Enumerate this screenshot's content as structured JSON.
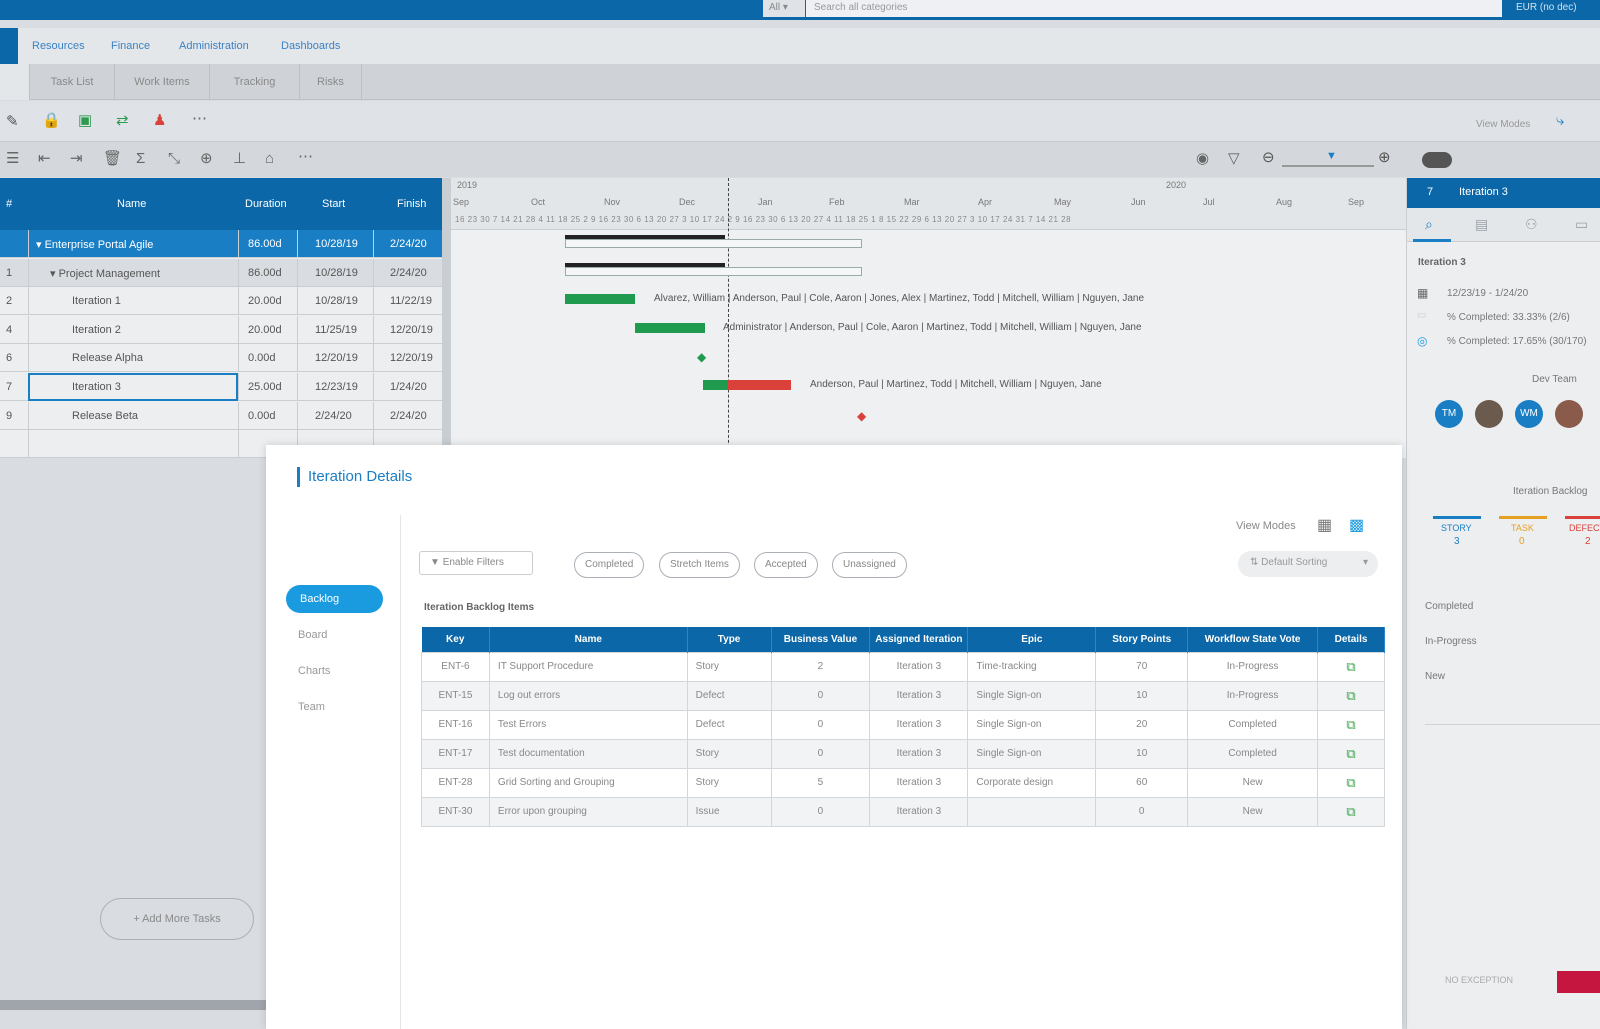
{
  "topbar": {
    "search_scope": "All ▾",
    "search_placeholder": "Search all categories",
    "currency": "EUR (no dec)"
  },
  "menu": [
    "Resources",
    "Finance",
    "Administration",
    "Dashboards"
  ],
  "subtabs": [
    "Task List",
    "Work Items",
    "Tracking",
    "Risks"
  ],
  "toolbar": {
    "view_modes": "View Modes"
  },
  "grid": {
    "headers": {
      "num": "#",
      "name": "Name",
      "duration": "Duration",
      "start": "Start",
      "finish": "Finish"
    },
    "rows": [
      {
        "num": "",
        "name": "▾ Enterprise Portal Agile",
        "duration": "86.00d",
        "start": "10/28/19",
        "finish": "2/24/20"
      },
      {
        "num": "1",
        "name": "▾ Project Management",
        "duration": "86.00d",
        "start": "10/28/19",
        "finish": "2/24/20"
      },
      {
        "num": "2",
        "name": "Iteration 1",
        "duration": "20.00d",
        "start": "10/28/19",
        "finish": "11/22/19"
      },
      {
        "num": "4",
        "name": "Iteration 2",
        "duration": "20.00d",
        "start": "11/25/19",
        "finish": "12/20/19"
      },
      {
        "num": "6",
        "name": "Release Alpha",
        "duration": "0.00d",
        "start": "12/20/19",
        "finish": "12/20/19"
      },
      {
        "num": "7",
        "name": "Iteration 3",
        "duration": "25.00d",
        "start": "12/23/19",
        "finish": "1/24/20"
      },
      {
        "num": "9",
        "name": "Release Beta",
        "duration": "0.00d",
        "start": "2/24/20",
        "finish": "2/24/20"
      }
    ]
  },
  "gantt": {
    "years": [
      "2019",
      "2020"
    ],
    "months": [
      "Sep",
      "Oct",
      "Nov",
      "Dec",
      "Jan",
      "Feb",
      "Mar",
      "Apr",
      "May",
      "Jun",
      "Jul",
      "Aug",
      "Sep"
    ],
    "days": "16 23 30  7 14 21 28  4 11 18 25  2  9 16 23 30  6 13 20 27  3 10 17 24  2  9 16 23 30  6 13 20 27  4 11 18 25  1  8 15 22 29  6 13 20 27  3 10 17 24 31  7 14 21 28",
    "labels": {
      "iter1": "Alvarez, William | Anderson, Paul | Cole, Aaron | Jones, Alex | Martinez, Todd | Mitchell, William | Nguyen, Jane",
      "iter2": "Administrator | Anderson, Paul | Cole, Aaron | Martinez, Todd | Mitchell, William | Nguyen, Jane",
      "iter3": "Anderson, Paul | Martinez, Todd | Mitchell, William | Nguyen, Jane"
    }
  },
  "right_panel": {
    "header_num": "7",
    "header_title": "Iteration 3",
    "name": "Iteration 3",
    "dates": "12/23/19 - 1/24/20",
    "pct1": "% Completed: 33.33% (2/6)",
    "pct2": "% Completed: 17.65% (30/170)",
    "dev_team": "Dev Team",
    "avatars": [
      "TM",
      "",
      "WM",
      ""
    ],
    "backlog_title": "Iteration Backlog",
    "types": [
      {
        "label": "STORY",
        "count": "3"
      },
      {
        "label": "TASK",
        "count": "0"
      },
      {
        "label": "DEFECT",
        "count": "2"
      }
    ],
    "statuses": [
      "Completed",
      "In-Progress",
      "New"
    ],
    "no_exception": "NO EXCEPTION"
  },
  "add_more_tasks": "+ Add More Tasks",
  "modal": {
    "title": "Iteration Details",
    "nav": [
      "Backlog",
      "Board",
      "Charts",
      "Team"
    ],
    "view_modes": "View Modes",
    "enable_filters": "Enable Filters",
    "chips": [
      "Completed",
      "Stretch Items",
      "Accepted",
      "Unassigned"
    ],
    "sorting": "Default Sorting",
    "section_label": "Iteration Backlog Items",
    "columns": [
      "Key",
      "Name",
      "Type",
      "Business Value",
      "Assigned Iteration",
      "Epic",
      "Story Points",
      "Workflow State Vote",
      "Details"
    ],
    "rows": [
      {
        "key": "ENT-6",
        "name": "IT Support Procedure",
        "type": "Story",
        "bv": "2",
        "iter": "Iteration 3",
        "epic": "Time-tracking",
        "sp": "70",
        "state": "In-Progress"
      },
      {
        "key": "ENT-15",
        "name": "Log out errors",
        "type": "Defect",
        "bv": "0",
        "iter": "Iteration 3",
        "epic": "Single Sign-on",
        "sp": "10",
        "state": "In-Progress"
      },
      {
        "key": "ENT-16",
        "name": "Test Errors",
        "type": "Defect",
        "bv": "0",
        "iter": "Iteration 3",
        "epic": "Single Sign-on",
        "sp": "20",
        "state": "Completed"
      },
      {
        "key": "ENT-17",
        "name": "Test documentation",
        "type": "Story",
        "bv": "0",
        "iter": "Iteration 3",
        "epic": "Single Sign-on",
        "sp": "10",
        "state": "Completed"
      },
      {
        "key": "ENT-28",
        "name": "Grid Sorting and Grouping",
        "type": "Story",
        "bv": "5",
        "iter": "Iteration 3",
        "epic": "Corporate design",
        "sp": "60",
        "state": "New"
      },
      {
        "key": "ENT-30",
        "name": "Error upon grouping",
        "type": "Issue",
        "bv": "0",
        "iter": "Iteration 3",
        "epic": "",
        "sp": "0",
        "state": "New"
      }
    ]
  },
  "colors": {
    "brand": "#0b67a8",
    "accent": "#1a9be0",
    "bar_done": "#1f9a4f",
    "bar_late": "#d9413a"
  }
}
